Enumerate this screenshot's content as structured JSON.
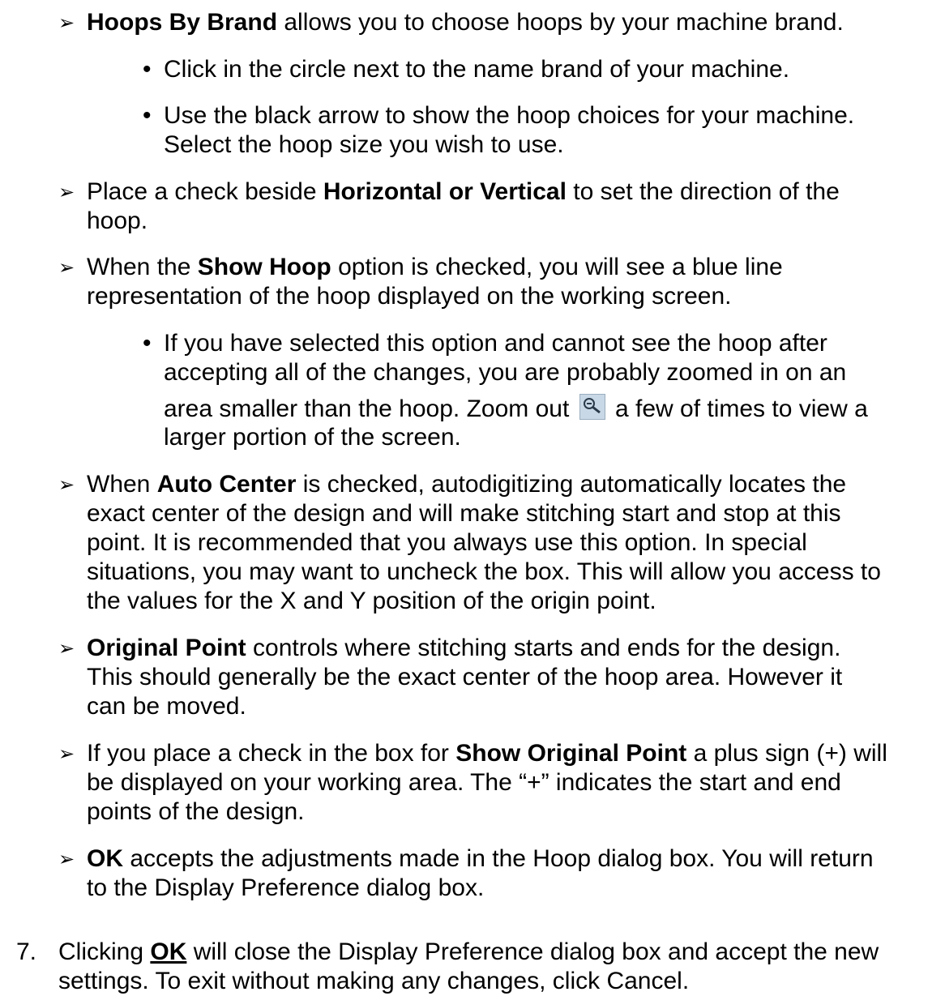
{
  "items": [
    {
      "bold": "Hoops By Brand",
      "text": " allows you to choose hoops by your machine brand."
    },
    {
      "text": "Place a check beside ",
      "bold": "Horizontal or Vertical",
      "text2": " to set the direction of the",
      "line2": "hoop."
    },
    {
      "text": "When the ",
      "bold": "Show Hoop",
      "text2": " option is checked, you will see a blue line",
      "line2": "representation of the hoop displayed on the working screen."
    },
    {
      "text": "When ",
      "bold": "Auto Center",
      "text2": " is checked, autodigitizing automatically locates the",
      "line2": "exact center of the design and will make stitching start and stop at this",
      "line3": "point.  It is recommended that you always use this option.  In special",
      "line4": "situations, you may want to uncheck the box.  This will allow you access to",
      "line5": "the values for the X and Y position of the origin point."
    },
    {
      "bold": "Original Point",
      "text": " controls where stitching starts and ends for the design.",
      "line2": "This should generally be the exact center of the hoop area.  However it",
      "line3": "can be moved."
    },
    {
      "text": "If you place a check in the box for ",
      "bold": "Show Original Point",
      "text2": " a plus sign (+) will",
      "line2": "be displayed on your working area.  The “+” indicates the start and end",
      "line3": "points of the design."
    },
    {
      "bold": "OK",
      "text": " accepts the adjustments made in the Hoop dialog box.  You will return",
      "line2": "to the Display Preference dialog box."
    }
  ],
  "sub1": [
    {
      "text": "Click in the circle next to the name brand of your machine."
    },
    {
      "text": "Use the black arrow to show the hoop choices for your machine.",
      "line2": "Select the hoop size you wish to use."
    }
  ],
  "sub2": {
    "line1": "If you have selected this option and cannot see the hoop after",
    "line2": "accepting all of the changes, you are probably zoomed in on an",
    "line3a": "area smaller than the hoop.  Zoom out",
    "line3b": "a few of times to view a",
    "line4": "larger portion of the screen."
  },
  "step": {
    "number": "7.",
    "text1": "Clicking ",
    "ok": "OK",
    "text2": " will close the Display Preference dialog box and accept the new",
    "line2": "settings.  To exit without making any changes, click Cancel."
  },
  "icons": {
    "arrow": "arrow-bullet-icon",
    "zoom": "zoom-out-icon"
  }
}
